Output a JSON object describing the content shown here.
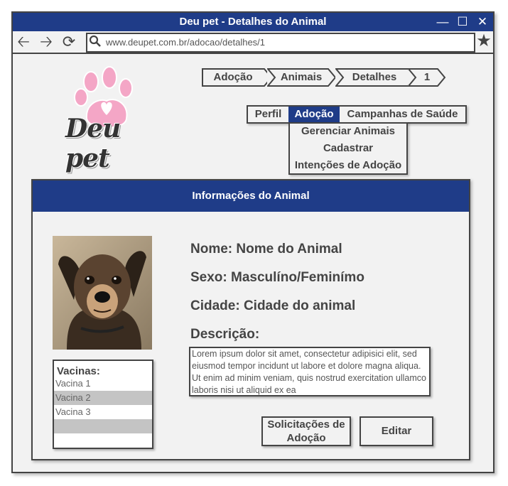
{
  "window": {
    "title": "Deu pet - Detalhes do Animal"
  },
  "browser": {
    "url": "www.deupet.com.br/adocao/detalhes/1"
  },
  "logo": {
    "text": "Deu pet"
  },
  "breadcrumb": [
    "Adoção",
    "Animais",
    "Detalhes",
    "1"
  ],
  "menu": {
    "items": [
      "Perfil",
      "Adoção",
      "Campanhas de Saúde"
    ],
    "active": "Adoção",
    "dropdown": [
      "Gerenciar Animais",
      "Cadastrar",
      "Intenções de Adoção"
    ]
  },
  "panel": {
    "title": "Informações do Animal",
    "fields": {
      "nome": "Nome: Nome do Animal",
      "sexo": "Sexo: Masculíno/Feminímo",
      "cidade": "Cidade: Cidade do animal",
      "descricao_label": "Descrição:"
    },
    "description": "Lorem ipsum dolor sit amet, consectetur adipisici elit, sed eiusmod tempor incidunt ut labore et dolore magna aliqua. Ut enim ad minim veniam, quis nostrud exercitation ullamco laboris nisi ut aliquid ex ea",
    "vacinas": {
      "title": "Vacinas:",
      "items": [
        "Vacina 1",
        "Vacina 2",
        "Vacina 3",
        ""
      ]
    },
    "buttons": {
      "solicitacoes": "Solicitações de Adoção",
      "editar": "Editar"
    }
  },
  "colors": {
    "accent": "#1f3c88",
    "paw": "#f4a6c6",
    "row_highlight": "#c4c4c4"
  }
}
